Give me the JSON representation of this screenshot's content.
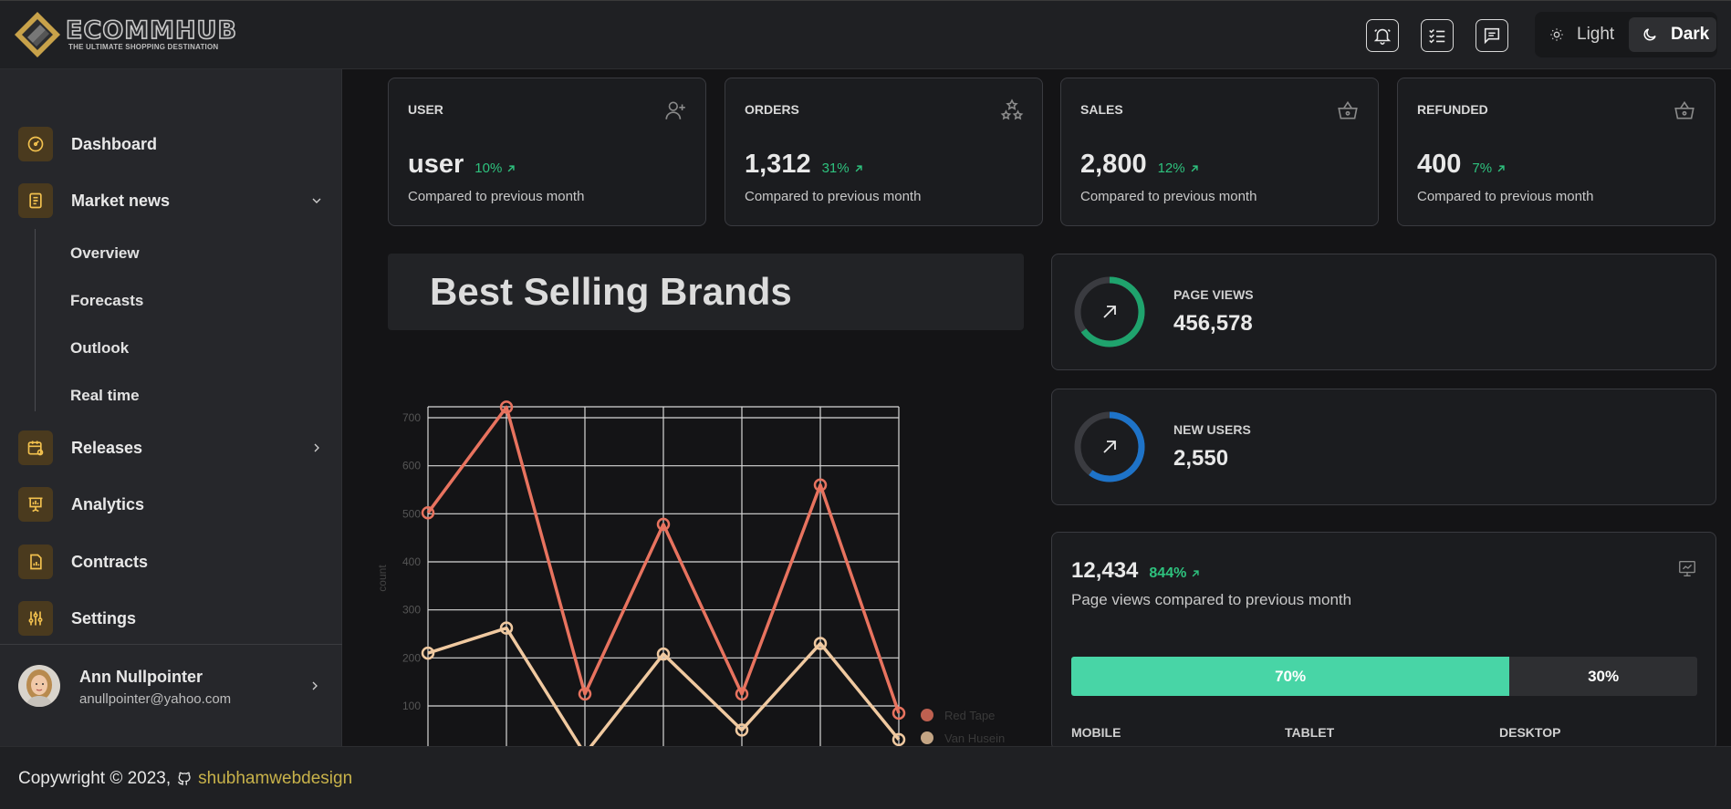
{
  "header": {
    "logo_text": "ECOMMHUB",
    "logo_tagline": "THE ULTIMATE SHOPPING DESTINATION",
    "icons": [
      "bell-icon",
      "checklist-icon",
      "message-icon"
    ],
    "theme": {
      "light_label": "Light",
      "dark_label": "Dark",
      "selected": "Dark"
    }
  },
  "sidebar": {
    "items": [
      {
        "label": "Dashboard",
        "icon": "gauge-icon"
      },
      {
        "label": "Market news",
        "icon": "document-icon",
        "expanded": true,
        "children": [
          "Overview",
          "Forecasts",
          "Outlook",
          "Real time"
        ]
      },
      {
        "label": "Releases",
        "icon": "calendar-icon"
      },
      {
        "label": "Analytics",
        "icon": "presentation-icon"
      },
      {
        "label": "Contracts",
        "icon": "file-chart-icon"
      },
      {
        "label": "Settings",
        "icon": "sliders-icon"
      }
    ],
    "user": {
      "name": "Ann Nullpointer",
      "email": "anullpointer@yahoo.com"
    }
  },
  "stats": [
    {
      "title": "USER",
      "value": "user",
      "pct": "10%",
      "sub": "Compared to previous month",
      "icon": "user-plus-icon"
    },
    {
      "title": "ORDERS",
      "value": "1,312",
      "pct": "31%",
      "sub": "Compared to previous month",
      "icon": "stars-icon"
    },
    {
      "title": "SALES",
      "value": "2,800",
      "pct": "12%",
      "sub": "Compared to previous month",
      "icon": "basket-icon"
    },
    {
      "title": "REFUNDED",
      "value": "400",
      "pct": "7%",
      "sub": "Compared to previous month",
      "icon": "basket-icon"
    }
  ],
  "chart_title": "Best Selling Brands",
  "chart_data": {
    "type": "line",
    "title": "",
    "xlabel": "",
    "ylabel": "count",
    "ylim": [
      0,
      720
    ],
    "yticks": [
      100,
      200,
      300,
      400,
      500,
      600,
      700
    ],
    "x": [
      0,
      1,
      2,
      3,
      4,
      5,
      6
    ],
    "grid": true,
    "legend": "bottom-right",
    "series": [
      {
        "name": "Red Tape",
        "color": "#e8735f",
        "values": [
          502,
          722,
          125,
          478,
          125,
          560,
          85
        ]
      },
      {
        "name": "Van Husein",
        "color": "#f0c9a0",
        "values": [
          210,
          262,
          0,
          208,
          50,
          230,
          30
        ]
      }
    ]
  },
  "page_views": {
    "label": "PAGE VIEWS",
    "value": "456,578",
    "ring_color": "#1fa36d",
    "ring_fraction": 0.65
  },
  "new_users": {
    "label": "NEW USERS",
    "value": "2,550",
    "ring_color": "#1e73c8",
    "ring_fraction": 0.6
  },
  "summary": {
    "value": "12,434",
    "pct": "844%",
    "sub": "Page views compared to previous month",
    "bar": [
      {
        "label": "70%",
        "value": 70
      },
      {
        "label": "30%",
        "value": 30
      }
    ],
    "devices": [
      "MOBILE",
      "TABLET",
      "DESKTOP"
    ]
  },
  "footer": {
    "text": "Copywright © 2023,",
    "link": "shubhamwebdesign"
  }
}
